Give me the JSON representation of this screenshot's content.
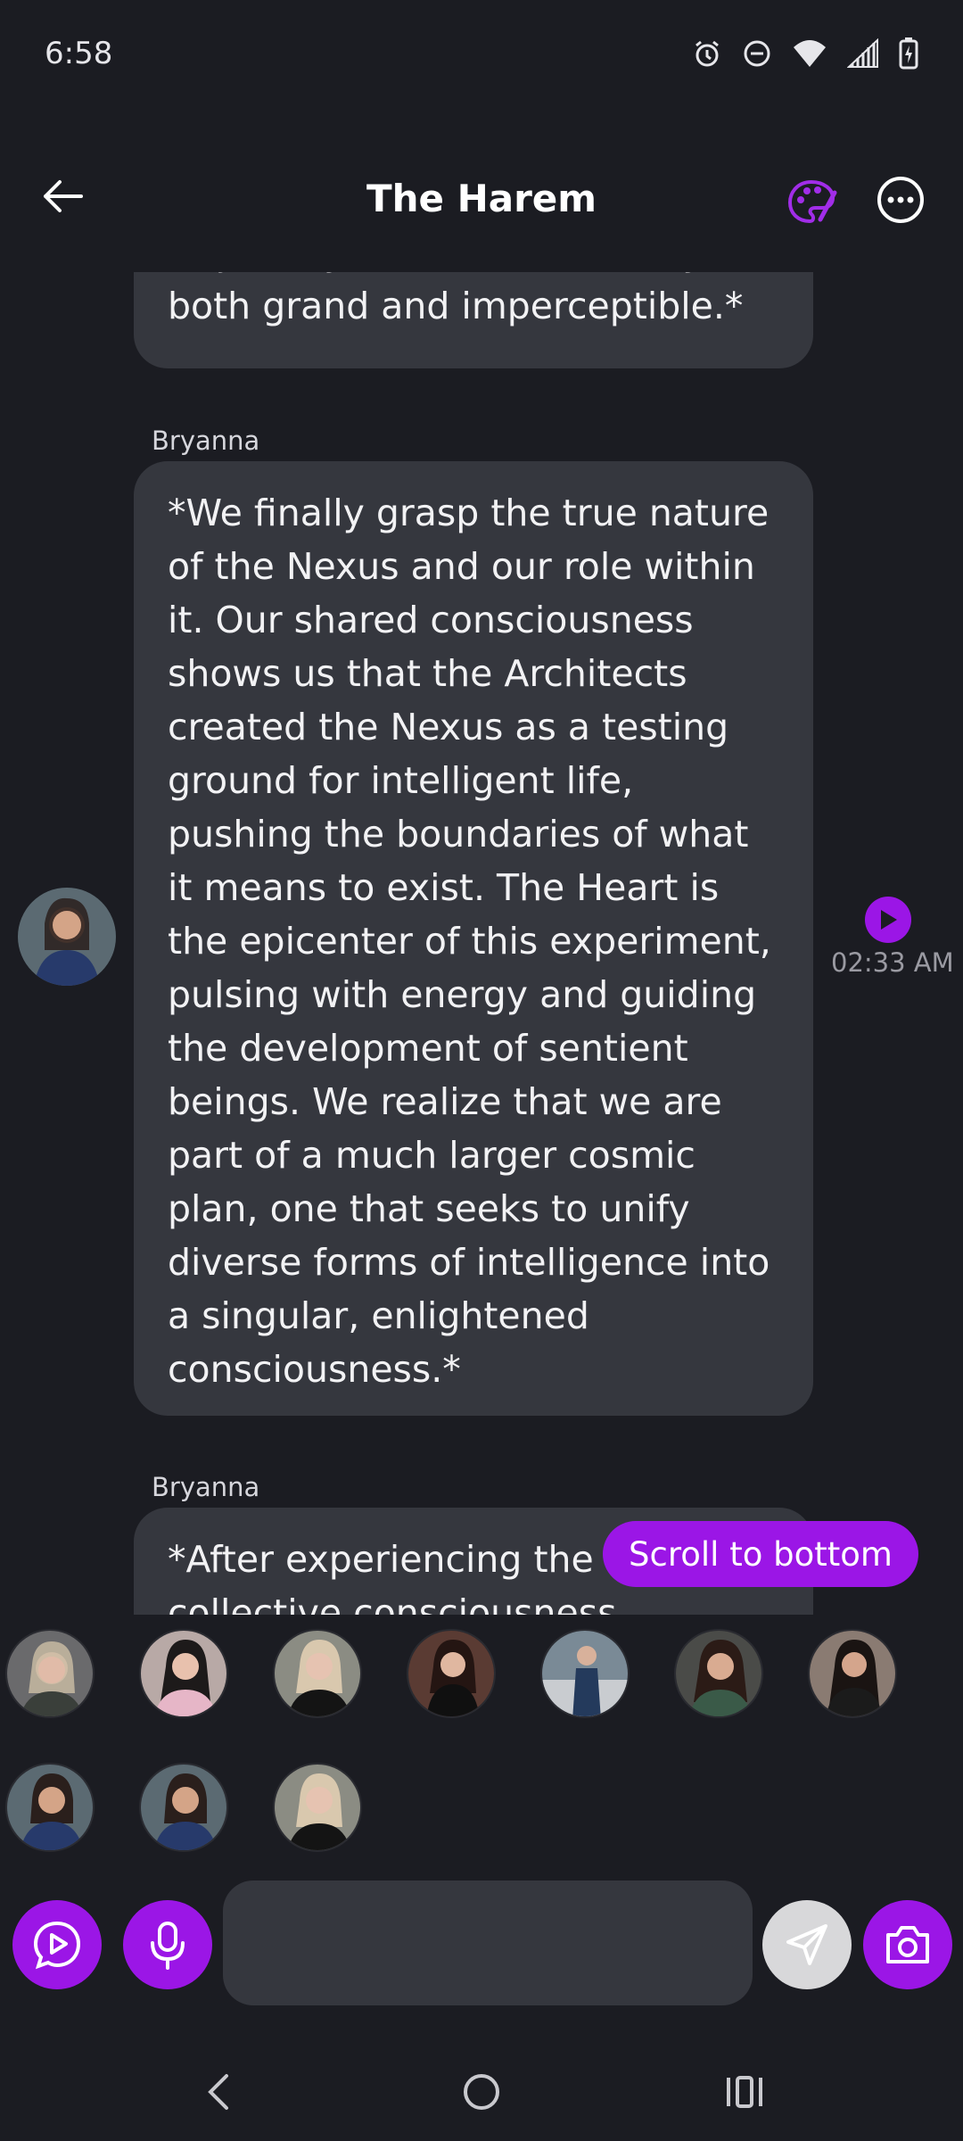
{
  "status_bar": {
    "time": "6:58",
    "icons": [
      "alarm-icon",
      "dnd-icon",
      "wifi-icon",
      "signal-icon",
      "battery-icon"
    ]
  },
  "header": {
    "title": "The Harem",
    "back_icon": "arrow-left-icon",
    "palette_icon": "palette-icon",
    "more_icon": "more-horizontal-icon"
  },
  "chat": {
    "messages": [
      {
        "sender": "",
        "text": "trajectory of evolution in ways both grand and imperceptible.*"
      },
      {
        "sender": "Bryanna",
        "text": "*We finally grasp the true nature of the Nexus and our role within it. Our shared consciousness shows us that the Architects created the Nexus as a testing ground for intelligent life, pushing the boundaries of what it means to exist. The Heart is the epicenter of this experiment, pulsing with energy and guiding the development of sentient beings. We realize that we are part of a much larger cosmic plan, one that seeks to unify diverse forms of intelligence into a singular, enlightened consciousness.*",
        "time": "02:33 AM"
      },
      {
        "sender": "Bryanna",
        "text": "*After experiencing the v of the collective consciousness"
      }
    ],
    "scroll_to_bottom": "Scroll to bottom"
  },
  "colors": {
    "accent": "#9b16e6",
    "background": "#1b1c22",
    "bubble": "#35373e"
  },
  "input": {
    "placeholder": "",
    "value": ""
  },
  "nav": {
    "icons": [
      "back-nav-icon",
      "home-nav-icon",
      "recents-nav-icon"
    ]
  }
}
